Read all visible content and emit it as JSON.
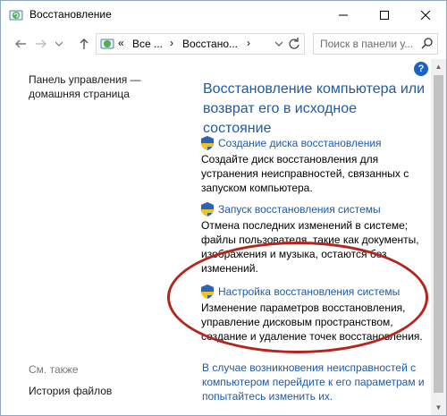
{
  "window": {
    "title": "Восстановление"
  },
  "address": {
    "overflow": "«",
    "segments": [
      "Все ...",
      "Восстано..."
    ],
    "separator": "›"
  },
  "search": {
    "placeholder": "Поиск в панели у..."
  },
  "sidebar": {
    "home_link": "Панель управления — домашняя страница",
    "see_also_label": "См. также",
    "see_also_items": [
      "История файлов"
    ]
  },
  "main": {
    "title": "Восстановление компьютера или возврат его в исходное состояние",
    "items": [
      {
        "link": "Создание диска восстановления",
        "description": "Создайте диск восстановления для устранения неисправностей, связанных с запуском компьютера."
      },
      {
        "link": "Запуск восстановления системы",
        "description": "Отмена последних изменений в системе; файлы пользователя, такие как документы, изображения и музыка, остаются без изменений."
      },
      {
        "link": "Настройка восстановления системы",
        "description": "Изменение параметров восстановления, управление дисковым пространством, создание и удаление точек восстановления."
      }
    ],
    "bottom_link": "В случае возникновения неисправностей с компьютером перейдите к его параметрам и попытайтесь изменить их."
  },
  "colors": {
    "link": "#1e5aa8",
    "highlight": "#b6251d",
    "help": "#1e63c4"
  },
  "icons": [
    "recovery-icon",
    "back-arrow-icon",
    "forward-arrow-icon",
    "dropdown-icon",
    "up-arrow-icon",
    "refresh-icon",
    "search-icon",
    "help-icon",
    "uac-shield-icon"
  ]
}
